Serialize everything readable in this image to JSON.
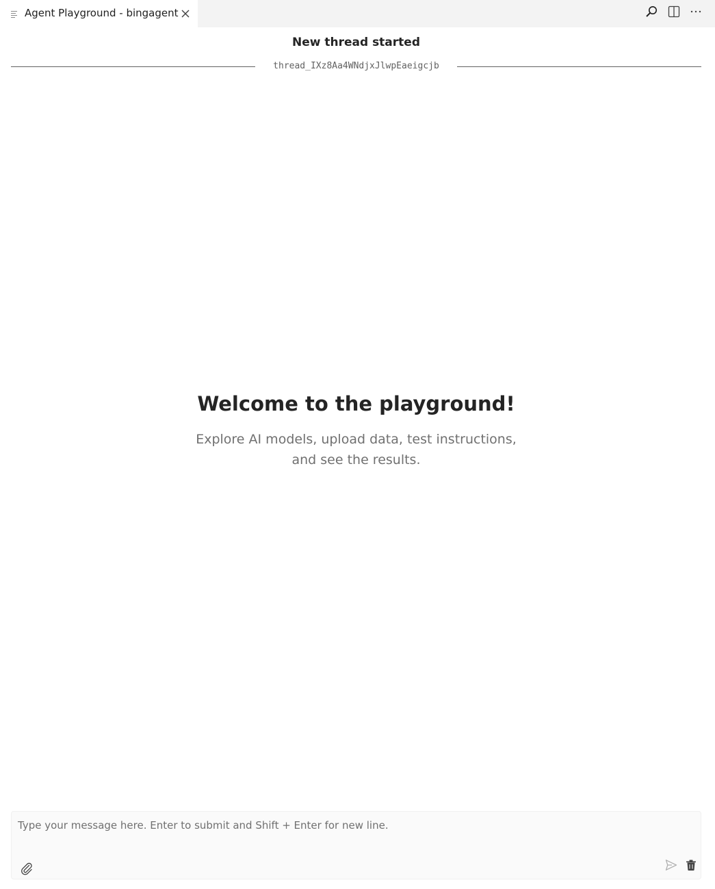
{
  "tab": {
    "title": "Agent Playground - bingagent",
    "icon": "list-icon",
    "close_icon": "close-icon"
  },
  "toolbar": {
    "icons": [
      "search-icon",
      "split-editor-icon",
      "more-icon"
    ]
  },
  "thread": {
    "status": "New thread started",
    "id": "thread_IXz8Aa4WNdjxJlwpEaeigcjb"
  },
  "welcome": {
    "title": "Welcome to the playground!",
    "subtitle_line1": "Explore AI models, upload data, test instructions,",
    "subtitle_line2": "and see the results."
  },
  "composer": {
    "placeholder": "Type your message here. Enter to submit and Shift + Enter for new line.",
    "value": "",
    "icons": [
      "paperclip-icon",
      "send-icon",
      "trash-icon"
    ]
  },
  "colors": {
    "tabbar_bg": "#f3f3f3",
    "text_primary": "#242424",
    "text_secondary": "#707070",
    "composer_bg": "#fafafa"
  }
}
